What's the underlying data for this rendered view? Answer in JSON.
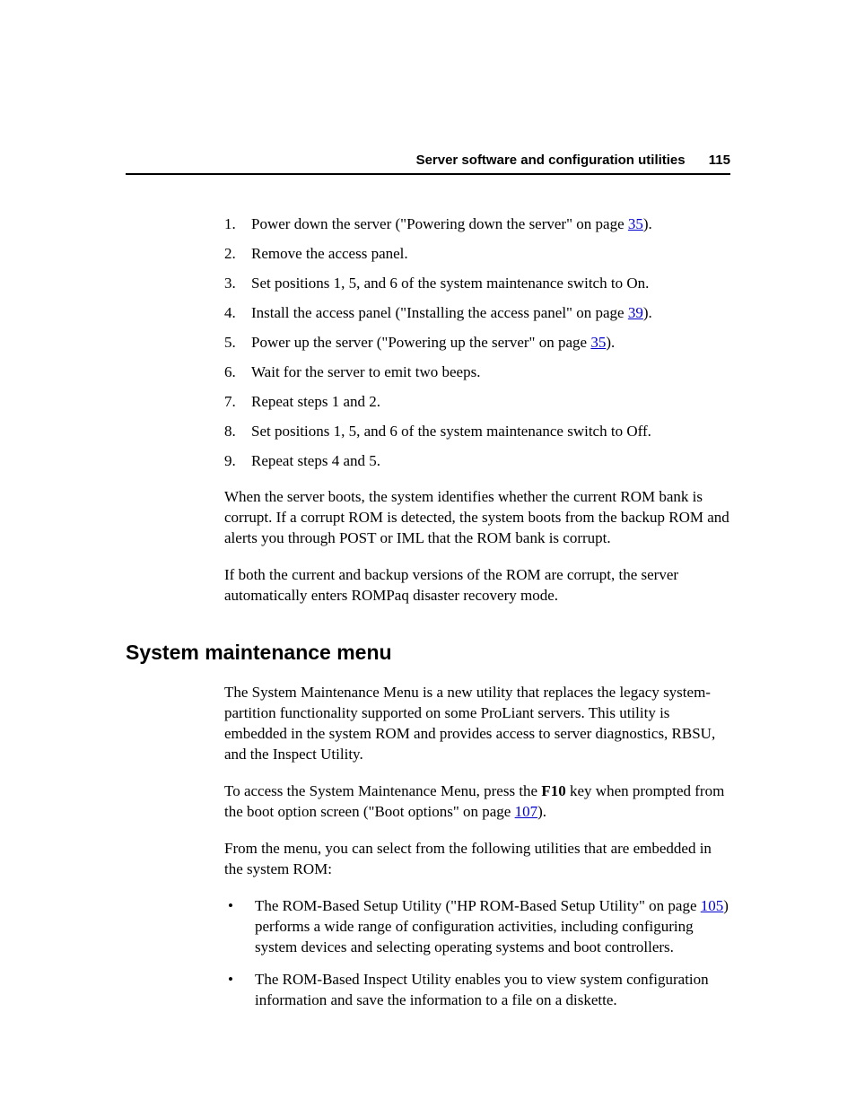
{
  "header": {
    "title": "Server software and configuration utilities",
    "pageNumber": "115"
  },
  "ol": {
    "n1": "1.",
    "t1a": "Power down the server (\"Powering down the server\" on page ",
    "t1link": "35",
    "t1b": ").",
    "n2": "2.",
    "t2": "Remove the access panel.",
    "n3": "3.",
    "t3": "Set positions 1, 5, and 6 of the system maintenance switch to On.",
    "n4": "4.",
    "t4a": "Install the access panel (\"Installing the access panel\" on page ",
    "t4link": "39",
    "t4b": ").",
    "n5": "5.",
    "t5a": "Power up the server (\"Powering up the server\" on page ",
    "t5link": "35",
    "t5b": ").",
    "n6": "6.",
    "t6": "Wait for the server to emit two beeps.",
    "n7": "7.",
    "t7": "Repeat steps 1 and 2.",
    "n8": "8.",
    "t8": "Set positions 1, 5, and 6 of the system maintenance switch to Off.",
    "n9": "9.",
    "t9": "Repeat steps 4 and 5."
  },
  "p1": "When the server boots, the system identifies whether the current ROM bank is corrupt. If a corrupt ROM is detected, the system boots from the backup ROM and alerts you through POST or IML that the ROM bank is corrupt.",
  "p2": "If both the current and backup versions of the ROM are corrupt, the server automatically enters ROMPaq disaster recovery mode.",
  "h2": "System maintenance menu",
  "p3": "The System Maintenance Menu is a new utility that replaces the legacy system-partition functionality supported on some ProLiant servers. This utility is embedded in the system ROM and provides access to server diagnostics, RBSU, and the Inspect Utility.",
  "p4a": "To access the System Maintenance Menu, press the ",
  "p4bold": "F10",
  "p4b": " key when prompted from the boot option screen (\"Boot options\" on page ",
  "p4link": "107",
  "p4c": ").",
  "p5": "From the menu, you can select from the following utilities that are embedded in the system ROM:",
  "bul": {
    "dot": "•",
    "b1a": "The ROM-Based Setup Utility (\"HP ROM-Based Setup Utility\" on page ",
    "b1link": "105",
    "b1b": ") performs a wide range of configuration activities, including configuring system devices and selecting operating systems and boot controllers.",
    "b2": "The ROM-Based Inspect Utility enables you to view system configuration information and save the information to a file on a diskette."
  }
}
